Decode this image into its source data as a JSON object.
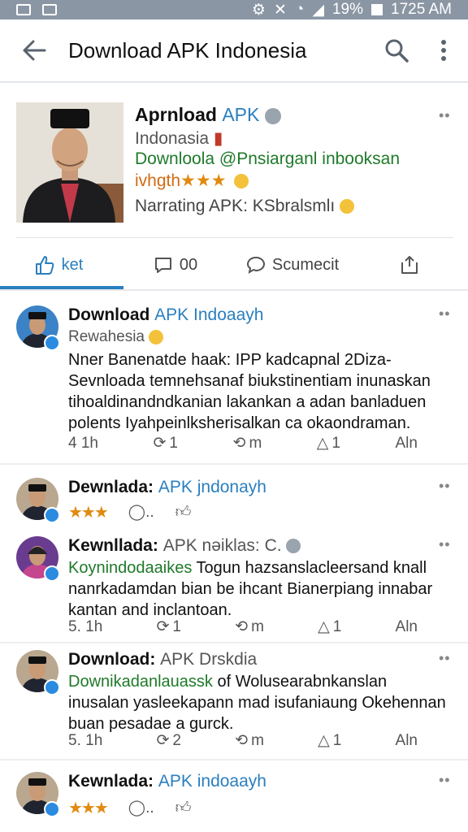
{
  "status_bar": {
    "battery": "19%",
    "time": "1725 AM"
  },
  "app_bar": {
    "title": "Download APK Indonesia"
  },
  "profile": {
    "name_bold": "Aprnload",
    "name_blue": "APK",
    "region": "Indonasia",
    "tagline": "Downloola @Pnsiarganl inbooksan",
    "rating_text": "ivhgth",
    "rating_stars": "★★★",
    "narrating": "Narrating APK: KSbralsmlı"
  },
  "tabs": [
    {
      "label": "ket"
    },
    {
      "label": "00"
    },
    {
      "label": "Scumecit"
    },
    {
      "label": ""
    }
  ],
  "posts": [
    {
      "title_bold": "Download",
      "title_rest": "APK Indoaayh",
      "subtitle": "Rewahesia",
      "body": "Nner Banenatde haak: IPP kadcapnal 2Diza- Sevnloada temnehsanaf biukstinentiam inunaskan tihoaldinandndkanian lakankan a adan banladuen polents Iyahpeinlksherisalkan ca okaondraman.",
      "meta": [
        "4 1h",
        "1",
        "m",
        "1",
        "Aln"
      ]
    },
    {
      "title_bold": "Dewnlada:",
      "title_rest": "APK jndonayh",
      "stars": "★★★",
      "react_more": "..",
      "meta": []
    },
    {
      "title_bold": "Kewnllada:",
      "title_rest": "APK nəiklas: C.",
      "body_green": "Koynindodaaikes",
      "body": "Togun hazsanslacleersand knall nanrkadamdan bian be ihcant Bianerpiang innabar kantan and inclantoan.",
      "meta": [
        "5. 1h",
        "1",
        "m",
        "1",
        "Aln"
      ]
    },
    {
      "title_bold": "Download:",
      "title_rest": "APK Drskdia",
      "body_green": "Downikadanlauassk",
      "body": "of Wolusearabnkanslan inusalan yasleekapann mad isufaniaung Okehennan buan pesadae a gurck.",
      "meta": [
        "5. 1h",
        "2",
        "m",
        "1",
        "Aln"
      ]
    },
    {
      "title_bold": "Kewnlada:",
      "title_rest": "APK indoaayh",
      "stars": "★★★",
      "react_more": "..",
      "meta": []
    }
  ],
  "colors": {
    "accent": "#2a7fbf",
    "green": "#1f7a2a",
    "star": "#e08a10",
    "status_bar": "#8a96a4"
  }
}
